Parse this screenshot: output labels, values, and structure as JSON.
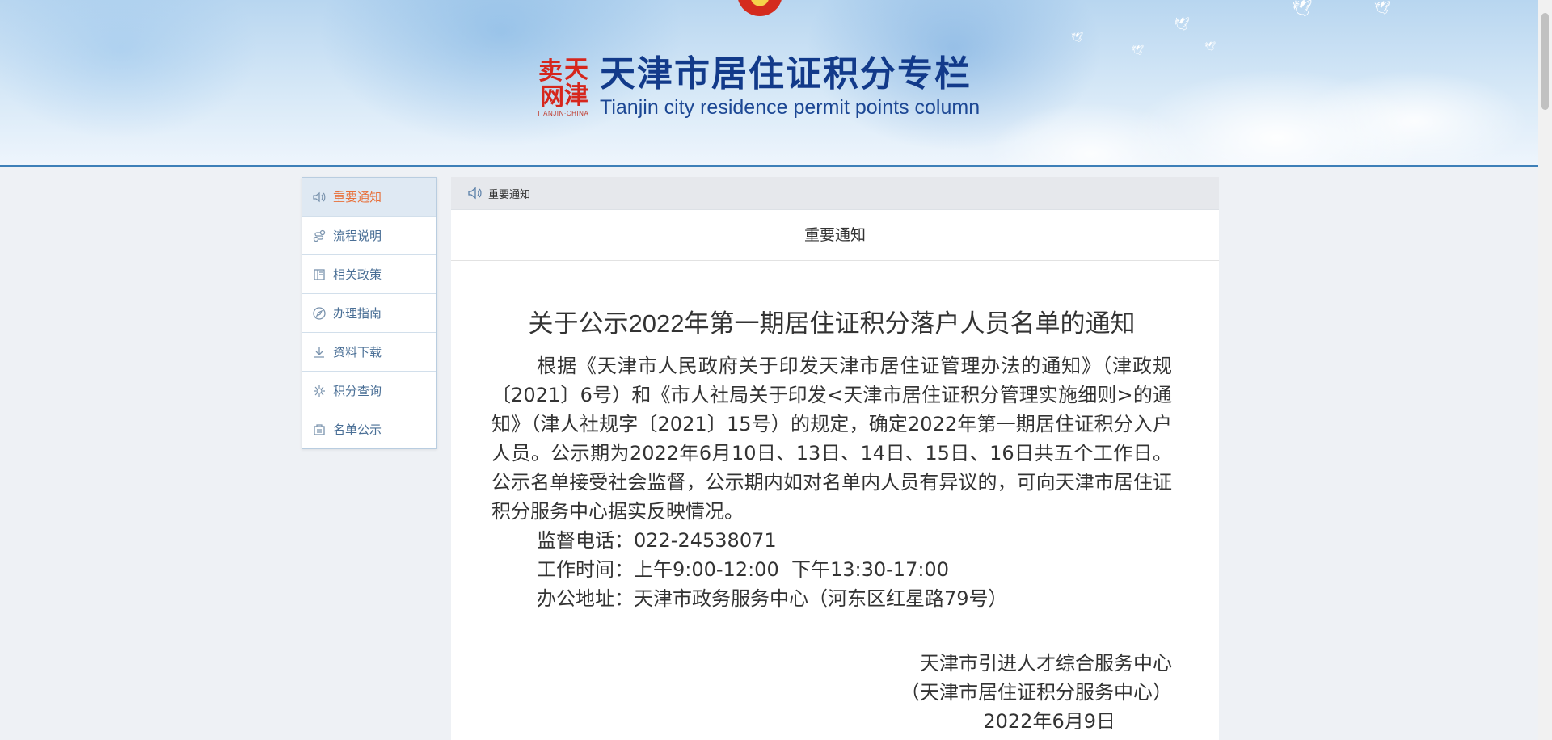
{
  "banner": {
    "seal_chars": [
      "天",
      "津",
      "卖",
      "网"
    ],
    "seal_subtext": "TIANJIN·CHINA",
    "title": "天津市居住证积分专栏",
    "subtitle": "Tianjin city residence permit points column"
  },
  "sidebar": {
    "items": [
      {
        "label": "重要通知",
        "icon": "speaker-icon",
        "active": true
      },
      {
        "label": "流程说明",
        "icon": "flow-icon",
        "active": false
      },
      {
        "label": "相关政策",
        "icon": "book-icon",
        "active": false
      },
      {
        "label": "办理指南",
        "icon": "compass-icon",
        "active": false
      },
      {
        "label": "资料下载",
        "icon": "download-icon",
        "active": false
      },
      {
        "label": "积分查询",
        "icon": "gear-icon",
        "active": false
      },
      {
        "label": "名单公示",
        "icon": "list-icon",
        "active": false
      }
    ]
  },
  "content": {
    "breadcrumb": "重要通知",
    "section_title": "重要通知",
    "doc_title": "关于公示2022年第一期居住证积分落户人员名单的通知",
    "body": "根据《天津市人民政府关于印发天津市居住证管理办法的通知》（津政规〔2021〕6号）和《市人社局关于印发<天津市居住证积分管理实施细则>的通知》（津人社规字〔2021〕15号）的规定，确定2022年第一期居住证积分入户人员。公示期为2022年6月10日、13日、14日、15日、16日共五个工作日。公示名单接受社会监督，公示期内如对名单内人员有异议的，可向天津市居住证积分服务中心据实反映情况。",
    "phone": "监督电话：022-24538071",
    "hours": "工作时间：上午9:00-12:00  下午13:30-17:00",
    "address": "办公地址：天津市政务服务中心（河东区红星路79号）",
    "signer1": "天津市引进人才综合服务中心",
    "signer2": "（天津市居住证积分服务中心）",
    "date": "2022年6月9日"
  },
  "colors": {
    "title_blue": "#123a8a",
    "active_orange": "#e8703a",
    "sidebar_text": "#4a6f96",
    "banner_border": "#3d7fb8"
  }
}
